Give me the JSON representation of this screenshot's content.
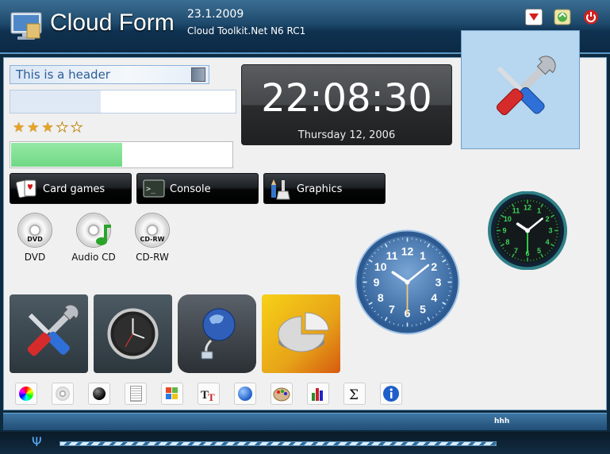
{
  "window": {
    "title": "Cloud Form",
    "date": "23.1.2009",
    "subtitle": "Cloud Toolkit.Net N6 RC1"
  },
  "header_box": {
    "text": "This is a header"
  },
  "progress_top": {
    "value_percent": 40
  },
  "rating": {
    "value": 3,
    "max": 5
  },
  "progress_green": {
    "value_percent": 50
  },
  "buttons": [
    {
      "label": "Card games",
      "icon": "cards-icon"
    },
    {
      "label": "Console",
      "icon": "terminal-icon"
    },
    {
      "label": "Graphics",
      "icon": "paint-icon"
    }
  ],
  "discs": [
    {
      "label": "DVD",
      "icon": "dvd-icon",
      "badge": "DVD"
    },
    {
      "label": "Audio CD",
      "icon": "audio-cd-icon",
      "badge": ""
    },
    {
      "label": "CD-RW",
      "icon": "cdrw-icon",
      "badge": "CD-RW"
    }
  ],
  "digital_clock": {
    "time": "22:08:30",
    "date": "Thursday 12, 2006"
  },
  "analog_clock_blue": {
    "hours": 10,
    "minutes": 8,
    "seconds": 30,
    "numbers": [
      "12",
      "1",
      "2",
      "3",
      "4",
      "5",
      "6",
      "7",
      "8",
      "9",
      "10",
      "11"
    ]
  },
  "analog_clock_dark": {
    "hours": 10,
    "minutes": 8,
    "seconds": 30,
    "numbers": [
      "12",
      "1",
      "2",
      "3",
      "4",
      "5",
      "6",
      "7",
      "8",
      "9",
      "10",
      "11"
    ]
  },
  "tiles": [
    {
      "icon": "tools-icon"
    },
    {
      "icon": "clock-icon"
    },
    {
      "icon": "network-globe-icon"
    },
    {
      "icon": "pie-chart-icon"
    }
  ],
  "toolbar_icons": [
    "color-wheel-icon",
    "cd-icon",
    "black-ball-icon",
    "document-icon",
    "windows-flag-icon",
    "fonts-icon",
    "globe-icon",
    "palette-icon",
    "bar-chart-icon",
    "sigma-icon",
    "info-icon"
  ],
  "status_bar": {
    "text": "hhh"
  },
  "taskbar": {
    "glyph": "Ψ",
    "progress_fraction": 1.0
  },
  "colors": {
    "accent": "#1e4a6c",
    "green": "#6fd884",
    "tile_blue": "#b7d6ef"
  }
}
